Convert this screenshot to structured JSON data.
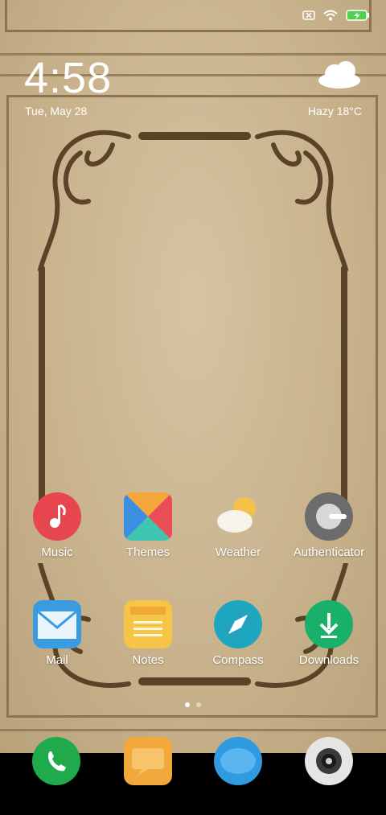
{
  "status_bar": {
    "icons": [
      "sim-none-icon",
      "wifi-icon",
      "battery-charging-icon"
    ]
  },
  "clock": {
    "time": "4:58",
    "date": "Tue, May 28"
  },
  "weather": {
    "text": "Hazy  18°C",
    "icon": "cloud-icon"
  },
  "home_apps": [
    {
      "label": "Music",
      "icon": "music-note-icon",
      "color": "#e8464f"
    },
    {
      "label": "Themes",
      "icon": "themes-icon",
      "color": "#e96a4f"
    },
    {
      "label": "Weather",
      "icon": "weather-icon",
      "color": "#f4c24a"
    },
    {
      "label": "Authenticator",
      "icon": "authenticator-icon",
      "color": "#6c6c6c"
    },
    {
      "label": "Mail",
      "icon": "mail-icon",
      "color": "#3a9be0"
    },
    {
      "label": "Notes",
      "icon": "notes-icon",
      "color": "#f6c548"
    },
    {
      "label": "Compass",
      "icon": "compass-icon",
      "color": "#1fa5c0"
    },
    {
      "label": "Downloads",
      "icon": "download-icon",
      "color": "#19b06a"
    }
  ],
  "page_indicator": {
    "count": 2,
    "active": 0
  },
  "dock": [
    {
      "icon": "phone-icon",
      "color": "#1faa4c"
    },
    {
      "icon": "messages-icon",
      "color": "#f0a93a"
    },
    {
      "icon": "browser-icon",
      "color": "#2f9be0"
    },
    {
      "icon": "camera-icon",
      "color": "#e5e5e5"
    }
  ]
}
